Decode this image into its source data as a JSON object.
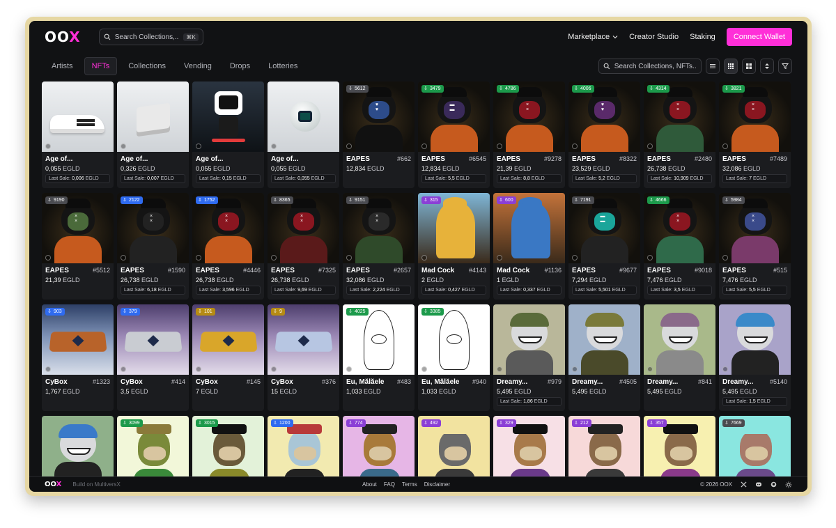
{
  "brand": {
    "logo_prefix": "OO",
    "logo_x": "X"
  },
  "header": {
    "search_placeholder": "Search Collections,...",
    "search_shortcut": "⌘K",
    "nav": [
      {
        "label": "Marketplace"
      },
      {
        "label": "Creator Studio"
      },
      {
        "label": "Staking"
      }
    ],
    "connect_label": "Connect Wallet"
  },
  "tabs": [
    {
      "label": "Artists",
      "active": false
    },
    {
      "label": "NFTs",
      "active": true
    },
    {
      "label": "Collections",
      "active": false
    },
    {
      "label": "Vending",
      "active": false
    },
    {
      "label": "Drops",
      "active": false
    },
    {
      "label": "Lotteries",
      "active": false
    }
  ],
  "filter": {
    "search_placeholder": "Search Collections, NFTs..."
  },
  "colors": {
    "accent": "#ff2fd8",
    "background": "#111214",
    "card": "#1b1c1f",
    "frame": "#e6d7a3"
  },
  "cards": [
    {
      "art": "shoe",
      "badge": "",
      "badge_color": "",
      "name": "Age of...",
      "number": "",
      "price": "0,055",
      "unit": "EGLD",
      "last_sale_label": "Last Sale:",
      "last_sale": "0,006",
      "last_unit": "EGLD"
    },
    {
      "art": "box",
      "badge": "",
      "badge_color": "",
      "name": "Age of...",
      "number": "",
      "price": "0,326",
      "unit": "EGLD",
      "last_sale_label": "Last Sale:",
      "last_sale": "0,007",
      "last_unit": "EGLD"
    },
    {
      "art": "robot",
      "badge": "",
      "badge_color": "",
      "name": "Age of...",
      "number": "",
      "price": "0,055",
      "unit": "EGLD",
      "last_sale_label": "Last Sale:",
      "last_sale": "0,15",
      "last_unit": "EGLD"
    },
    {
      "art": "ball",
      "badge": "",
      "badge_color": "",
      "name": "Age of...",
      "number": "",
      "price": "0,055",
      "unit": "EGLD",
      "last_sale_label": "Last Sale:",
      "last_sale": "0,055",
      "last_unit": "EGLD"
    },
    {
      "art": "ape",
      "face": "#2d4c8a",
      "body": "#111",
      "eyes": "♥ ♥",
      "badge": "5612",
      "badge_color": "gray",
      "name": "EAPES",
      "number": "#662",
      "price": "12,834",
      "unit": "EGLD",
      "last_sale_label": "",
      "last_sale": "",
      "last_unit": ""
    },
    {
      "art": "ape",
      "face": "#3a2a5a",
      "body": "#c65a1e",
      "eyes": "▬ ▬",
      "badge": "3479",
      "badge_color": "green",
      "name": "EAPES",
      "number": "#6545",
      "price": "12,834",
      "unit": "EGLD",
      "last_sale_label": "Last Sale:",
      "last_sale": "5,5",
      "last_unit": "EGLD"
    },
    {
      "art": "ape",
      "face": "#8a1620",
      "body": "#c65a1e",
      "eyes": "× ×",
      "badge": "4786",
      "badge_color": "green",
      "name": "EAPES",
      "number": "#9278",
      "price": "21,39",
      "unit": "EGLD",
      "last_sale_label": "Last Sale:",
      "last_sale": "8,8",
      "last_unit": "EGLD"
    },
    {
      "art": "ape",
      "face": "#5a2a6a",
      "body": "#c65a1e",
      "eyes": "♥ ♥",
      "badge": "4006",
      "badge_color": "green",
      "name": "EAPES",
      "number": "#8322",
      "price": "23,529",
      "unit": "EGLD",
      "last_sale_label": "Last Sale:",
      "last_sale": "5,2",
      "last_unit": "EGLD"
    },
    {
      "art": "ape",
      "face": "#8a1620",
      "body": "#2f5a3a",
      "eyes": "× ×",
      "badge": "4314",
      "badge_color": "green",
      "name": "EAPES",
      "number": "#2480",
      "price": "26,738",
      "unit": "EGLD",
      "last_sale_label": "Last Sale:",
      "last_sale": "10,909",
      "last_unit": "EGLD"
    },
    {
      "art": "ape",
      "face": "#8a1620",
      "body": "#c65a1e",
      "eyes": "× ×",
      "badge": "3821",
      "badge_color": "green",
      "name": "EAPES",
      "number": "#7489",
      "price": "32,086",
      "unit": "EGLD",
      "last_sale_label": "Last Sale:",
      "last_sale": "7",
      "last_unit": "EGLD"
    },
    {
      "art": "ape",
      "face": "#4a6a3a",
      "body": "#c65a1e",
      "eyes": "× ×",
      "badge": "9190",
      "badge_color": "gray",
      "name": "EAPES",
      "number": "#5512",
      "price": "21,39",
      "unit": "EGLD",
      "last_sale_label": "",
      "last_sale": "",
      "last_unit": ""
    },
    {
      "art": "ape",
      "face": "#222",
      "body": "#222",
      "eyes": "× ×",
      "badge": "2122",
      "badge_color": "blue",
      "name": "EAPES",
      "number": "#1590",
      "price": "26,738",
      "unit": "EGLD",
      "last_sale_label": "Last Sale:",
      "last_sale": "6,18",
      "last_unit": "EGLD"
    },
    {
      "art": "ape",
      "face": "#8a1620",
      "body": "#c65a1e",
      "eyes": "× ×",
      "badge": "1752",
      "badge_color": "blue",
      "name": "EAPES",
      "number": "#4446",
      "price": "26,738",
      "unit": "EGLD",
      "last_sale_label": "Last Sale:",
      "last_sale": "3,596",
      "last_unit": "EGLD"
    },
    {
      "art": "ape",
      "face": "#8a1620",
      "body": "#5a1a1a",
      "eyes": "× ×",
      "badge": "8365",
      "badge_color": "gray",
      "name": "EAPES",
      "number": "#7325",
      "price": "26,738",
      "unit": "EGLD",
      "last_sale_label": "Last Sale:",
      "last_sale": "9,69",
      "last_unit": "EGLD"
    },
    {
      "art": "ape",
      "face": "#2a2a2a",
      "body": "#2f4a2a",
      "eyes": "× ×",
      "badge": "9151",
      "badge_color": "gray",
      "name": "EAPES",
      "number": "#2657",
      "price": "32,086",
      "unit": "EGLD",
      "last_sale_label": "Last Sale:",
      "last_sale": "2,224",
      "last_unit": "EGLD"
    },
    {
      "art": "cock",
      "c1": "#7fb6d6",
      "c2": "#e7b23a",
      "badge": "315",
      "badge_color": "purple",
      "name": "Mad Cock",
      "number": "#4143",
      "price": "2",
      "unit": "EGLD",
      "last_sale_label": "Last Sale:",
      "last_sale": "0,427",
      "last_unit": "EGLD"
    },
    {
      "art": "cock",
      "c1": "#c4733a",
      "c2": "#3a78c4",
      "badge": "600",
      "badge_color": "purple",
      "name": "Mad Cock",
      "number": "#1136",
      "price": "1",
      "unit": "EGLD",
      "last_sale_label": "Last Sale:",
      "last_sale": "0,337",
      "last_unit": "EGLD"
    },
    {
      "art": "ape",
      "face": "#1aa59a",
      "body": "#222",
      "eyes": "▬ ▬",
      "badge": "7191",
      "badge_color": "gray",
      "name": "EAPES",
      "number": "#9677",
      "price": "7,294",
      "unit": "EGLD",
      "last_sale_label": "Last Sale:",
      "last_sale": "5,501",
      "last_unit": "EGLD"
    },
    {
      "art": "ape",
      "face": "#8a1620",
      "body": "#2f6a4a",
      "eyes": "× ×",
      "badge": "4666",
      "badge_color": "green",
      "name": "EAPES",
      "number": "#9018",
      "price": "7,476",
      "unit": "EGLD",
      "last_sale_label": "Last Sale:",
      "last_sale": "3,5",
      "last_unit": "EGLD"
    },
    {
      "art": "ape",
      "face": "#3a4a8a",
      "body": "#7a3a6a",
      "eyes": "× ×",
      "badge": "5984",
      "badge_color": "gray",
      "name": "EAPES",
      "number": "#515",
      "price": "7,476",
      "unit": "EGLD",
      "last_sale_label": "Last Sale:",
      "last_sale": "5,5",
      "last_unit": "EGLD"
    },
    {
      "art": "cybox",
      "bg": "bg-snow",
      "c1": "#b8632a",
      "badge": "903",
      "badge_color": "blue",
      "name": "CyBox",
      "number": "#1323",
      "price": "1,767",
      "unit": "EGLD",
      "last_sale_label": "",
      "last_sale": "",
      "last_unit": ""
    },
    {
      "art": "cybox",
      "bg": "bg-snow-p",
      "c1": "#c9ccd2",
      "badge": "379",
      "badge_color": "blue",
      "name": "CyBox",
      "number": "#414",
      "price": "3,5",
      "unit": "EGLD",
      "last_sale_label": "",
      "last_sale": "",
      "last_unit": ""
    },
    {
      "art": "cybox",
      "bg": "bg-snow-p",
      "c1": "#d9a62a",
      "badge": "101",
      "badge_color": "gold",
      "name": "CyBox",
      "number": "#145",
      "price": "7",
      "unit": "EGLD",
      "last_sale_label": "",
      "last_sale": "",
      "last_unit": ""
    },
    {
      "art": "cybox",
      "bg": "bg-snow-p",
      "c1": "#b7c6e2",
      "badge": "9",
      "badge_color": "gold",
      "name": "CyBox",
      "number": "#376",
      "price": "15",
      "unit": "EGLD",
      "last_sale_label": "",
      "last_sale": "",
      "last_unit": ""
    },
    {
      "art": "sketch",
      "badge": "4025",
      "badge_color": "green",
      "name": "Eu, Mălăele",
      "number": "#483",
      "price": "1,033",
      "unit": "EGLD",
      "last_sale_label": "",
      "last_sale": "",
      "last_unit": ""
    },
    {
      "art": "sketch",
      "badge": "3385",
      "badge_color": "green",
      "name": "Eu, Mălăele",
      "number": "#940",
      "price": "1,033",
      "unit": "EGLD",
      "last_sale_label": "",
      "last_sale": "",
      "last_unit": ""
    },
    {
      "art": "dreamy",
      "bgc": "#b9b79a",
      "cap": "#5a6b3a",
      "body": "#5a5a5a",
      "badge": "",
      "badge_color": "",
      "name": "Dreamy...",
      "number": "#979",
      "price": "5,495",
      "unit": "EGLD",
      "last_sale_label": "Last Sale:",
      "last_sale": "1,86",
      "last_unit": "EGLD"
    },
    {
      "art": "dreamy",
      "bgc": "#9fb1c9",
      "cap": "#7a7a3a",
      "body": "#4a4a2a",
      "badge": "",
      "badge_color": "",
      "name": "Dreamy...",
      "number": "#4505",
      "price": "5,495",
      "unit": "EGLD",
      "last_sale_label": "",
      "last_sale": "",
      "last_unit": ""
    },
    {
      "art": "dreamy",
      "bgc": "#a9b98a",
      "cap": "#8a6a8a",
      "body": "#8a8a8a",
      "badge": "",
      "badge_color": "",
      "name": "Dreamy...",
      "number": "#841",
      "price": "5,495",
      "unit": "EGLD",
      "last_sale_label": "",
      "last_sale": "",
      "last_unit": ""
    },
    {
      "art": "dreamy",
      "bgc": "#a9a3c9",
      "cap": "#3a8ac9",
      "body": "#222",
      "badge": "",
      "badge_color": "",
      "name": "Dreamy...",
      "number": "#5140",
      "price": "5,495",
      "unit": "EGLD",
      "last_sale_label": "Last Sale:",
      "last_sale": "1,5",
      "last_unit": "EGLD"
    },
    {
      "art": "dreamy",
      "bgc": "#8fb08a",
      "cap": "#3a7ac9",
      "body": "#222",
      "badge": "",
      "badge_color": "",
      "name": "",
      "number": "",
      "price": "",
      "unit": "",
      "last_sale_label": "",
      "last_sale": "",
      "last_unit": ""
    },
    {
      "art": "bayc",
      "bgc": "#f2f7d9",
      "fur": "#7a8a3a",
      "bodyc": "#3a8a3a",
      "hat": "#8a7a3a",
      "badge": "3099",
      "badge_color": "green",
      "name": "",
      "number": "",
      "price": "",
      "unit": "",
      "last_sale_label": "",
      "last_sale": "",
      "last_unit": ""
    },
    {
      "art": "bayc",
      "bgc": "#e3f2d9",
      "fur": "#6a5a3a",
      "bodyc": "#8a8a2a",
      "hat": "#111",
      "badge": "3015",
      "badge_color": "green",
      "name": "",
      "number": "",
      "price": "",
      "unit": "",
      "last_sale_label": "",
      "last_sale": "",
      "last_unit": ""
    },
    {
      "art": "bayc",
      "bgc": "#f2eab0",
      "fur": "#a9c6d6",
      "bodyc": "#222",
      "hat": "#b83a3a",
      "badge": "1200",
      "badge_color": "blue",
      "name": "",
      "number": "",
      "price": "",
      "unit": "",
      "last_sale_label": "",
      "last_sale": "",
      "last_unit": ""
    },
    {
      "art": "bayc",
      "bgc": "#e6b6e6",
      "fur": "#a87a3a",
      "bodyc": "#3a6a8a",
      "hat": "#222",
      "badge": "774",
      "badge_color": "purple",
      "name": "",
      "number": "",
      "price": "",
      "unit": "",
      "last_sale_label": "",
      "last_sale": "",
      "last_unit": ""
    },
    {
      "art": "bayc",
      "bgc": "#f2e3a0",
      "fur": "#6a6a6a",
      "bodyc": "#3a3a3a",
      "hat": "#f2e3a0",
      "badge": "492",
      "badge_color": "purple",
      "name": "",
      "number": "",
      "price": "",
      "unit": "",
      "last_sale_label": "",
      "last_sale": "",
      "last_unit": ""
    },
    {
      "art": "bayc",
      "bgc": "#f7e0e6",
      "fur": "#a87a4a",
      "bodyc": "#6a3a8a",
      "hat": "#111",
      "badge": "329",
      "badge_color": "purple",
      "name": "",
      "number": "",
      "price": "",
      "unit": "",
      "last_sale_label": "",
      "last_sale": "",
      "last_unit": ""
    },
    {
      "art": "bayc",
      "bgc": "#f7d9d9",
      "fur": "#8a6a4a",
      "bodyc": "#3a3a3a",
      "hat": "#222",
      "badge": "212",
      "badge_color": "purple",
      "name": "",
      "number": "",
      "price": "",
      "unit": "",
      "last_sale_label": "",
      "last_sale": "",
      "last_unit": ""
    },
    {
      "art": "bayc",
      "bgc": "#f7f0b0",
      "fur": "#8a6a4a",
      "bodyc": "#8a3a8a",
      "hat": "#111",
      "badge": "357",
      "badge_color": "purple",
      "name": "",
      "number": "",
      "price": "",
      "unit": "",
      "last_sale_label": "",
      "last_sale": "",
      "last_unit": ""
    },
    {
      "art": "bayc",
      "bgc": "#8ae6e0",
      "fur": "#a87a6a",
      "bodyc": "#6a4a8a",
      "hat": "#8ae6e0",
      "badge": "7669",
      "badge_color": "gray",
      "name": "",
      "number": "",
      "price": "",
      "unit": "",
      "last_sale_label": "",
      "last_sale": "",
      "last_unit": ""
    }
  ],
  "footer": {
    "logo_prefix": "OO",
    "logo_x": "X",
    "built": "Build on MultiversX",
    "links": [
      {
        "label": "About"
      },
      {
        "label": "FAQ"
      },
      {
        "label": "Terms"
      },
      {
        "label": "Disclaimer"
      }
    ],
    "copyright": "© 2026 OOX"
  }
}
